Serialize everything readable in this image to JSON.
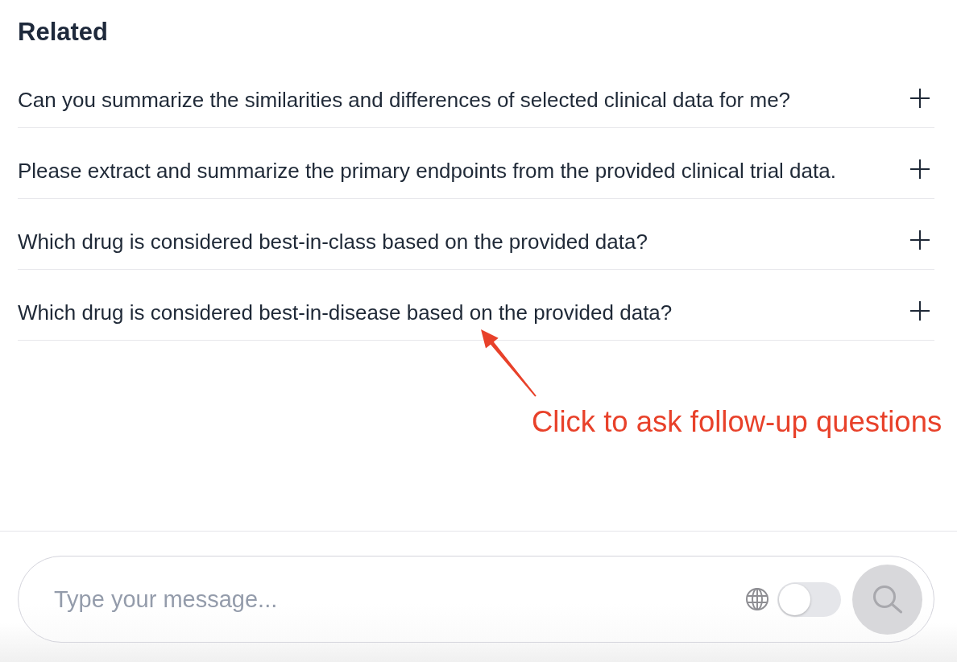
{
  "related": {
    "heading": "Related",
    "questions": [
      {
        "text": "Can you summarize the similarities and differences of selected clinical data for me?"
      },
      {
        "text": "Please extract and summarize the primary endpoints from the provided clinical trial data."
      },
      {
        "text": "Which drug is considered best-in-class based on the provided data?"
      },
      {
        "text": "Which drug is considered best-in-disease based on the provided data?"
      }
    ]
  },
  "annotation": {
    "text": "Click to ask follow-up questions"
  },
  "composer": {
    "placeholder": "Type your message...",
    "web_search_toggle": {
      "on": false
    },
    "search_button": {
      "disabled": true
    }
  }
}
